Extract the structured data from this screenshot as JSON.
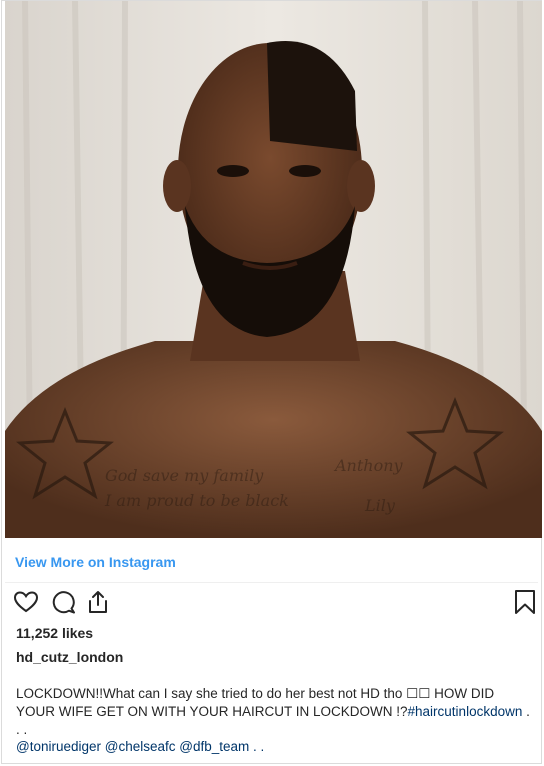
{
  "post": {
    "view_more_label": "View More on Instagram",
    "likes": "11,252 likes",
    "username": "hd_cutz_london",
    "caption_line1": "LOCKDOWN!!What can I say she tried to do her best not HD tho ☐☐ HOW DID",
    "caption_line2_prefix": "YOUR WIFE GET ON WITH YOUR HAIRCUT IN LOCKDOWN !?",
    "caption_hashtag": "#haircutinlockdown",
    "caption_ellipsis": " . . .",
    "mentions": [
      "@toniruediger",
      "@chelseafc",
      "@dfb_team"
    ],
    "mentions_suffix": " . ."
  },
  "icons": [
    "heart-icon",
    "comment-icon",
    "share-icon",
    "bookmark-icon"
  ],
  "colors": {
    "link": "#3897f0",
    "hashtag": "#003569",
    "text": "#262626"
  }
}
